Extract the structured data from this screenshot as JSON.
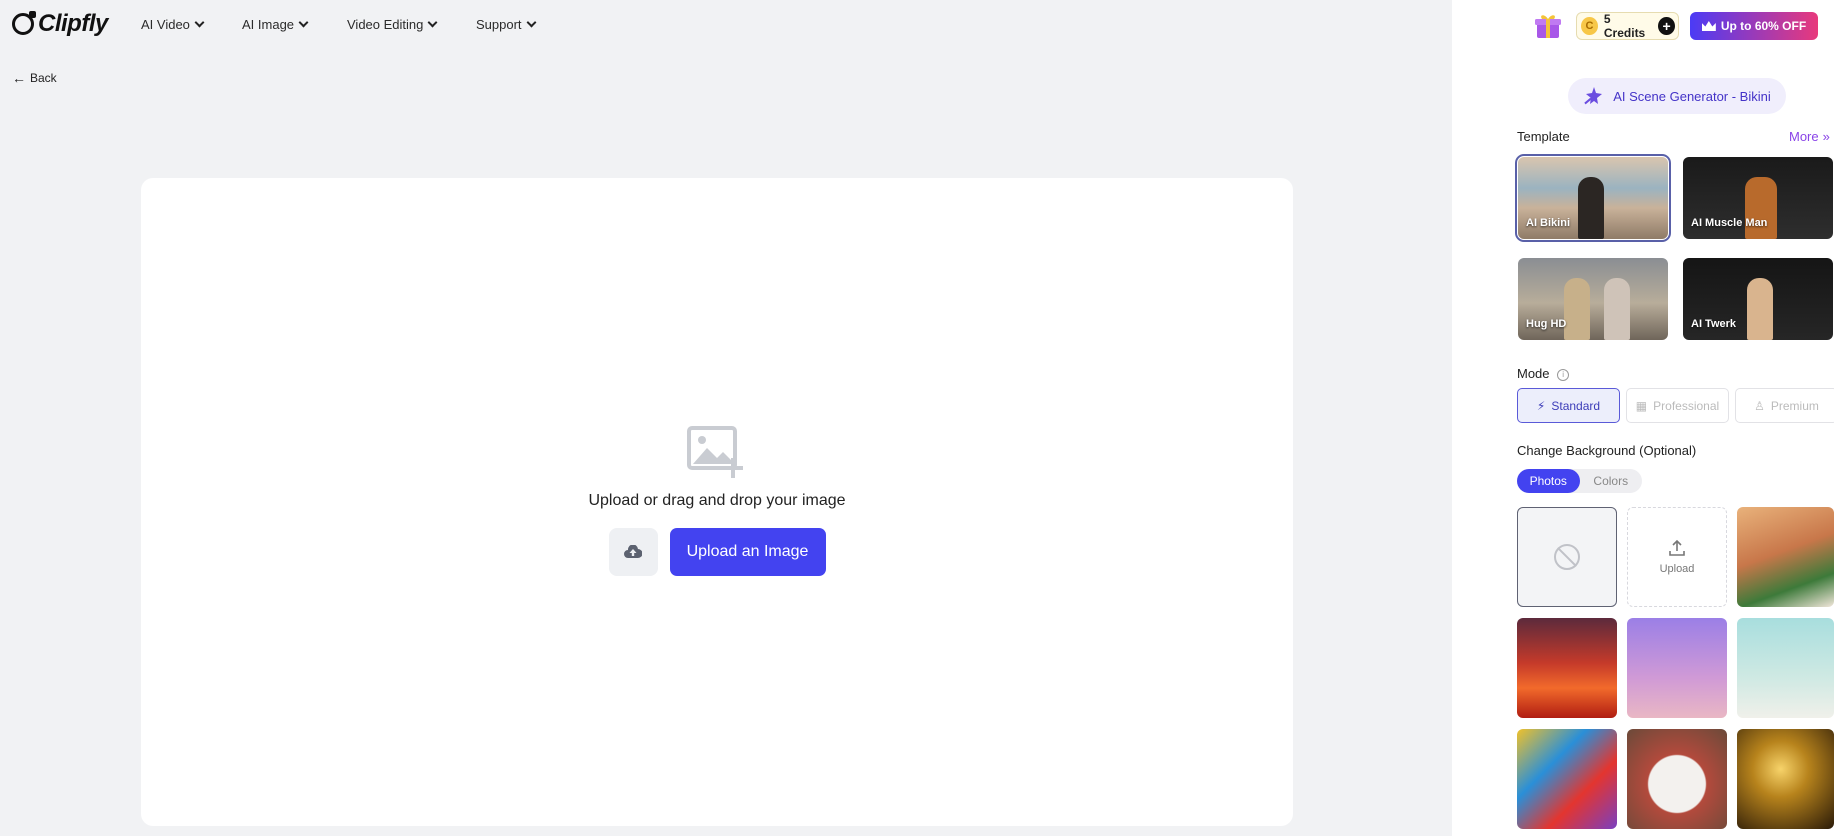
{
  "nav": {
    "logo": "Clipfly",
    "items": [
      {
        "label": "AI Video"
      },
      {
        "label": "AI Image"
      },
      {
        "label": "Video Editing"
      },
      {
        "label": "Support"
      }
    ],
    "back_label": "Back"
  },
  "main": {
    "upload_prompt": "Upload or drag and drop your image",
    "upload_button": "Upload an Image"
  },
  "panel": {
    "credits_label": "5 Credits",
    "coin_letter": "C",
    "promo_label": "Up to 60% OFF",
    "scene_label": "AI Scene Generator - Bikini",
    "template_label": "Template",
    "more_label": "More",
    "templates": [
      {
        "label": "AI Bikini",
        "selected": true
      },
      {
        "label": "AI Muscle Man",
        "selected": false
      },
      {
        "label": "Hug HD",
        "selected": false
      },
      {
        "label": "AI Twerk",
        "selected": false
      }
    ],
    "mode_label": "Mode",
    "modes": [
      {
        "label": "Standard",
        "active": true
      },
      {
        "label": "Professional",
        "active": false
      },
      {
        "label": "Premium",
        "active": false
      }
    ],
    "background_label": "Change Background (Optional)",
    "bg_tabs": [
      {
        "label": "Photos",
        "active": true
      },
      {
        "label": "Colors",
        "active": false
      }
    ],
    "upload_tile_label": "Upload"
  },
  "colors": {
    "accent": "#4343f0",
    "promo_start": "#4b3bf5",
    "promo_end": "#e8397c",
    "more_link": "#8a44e8"
  }
}
